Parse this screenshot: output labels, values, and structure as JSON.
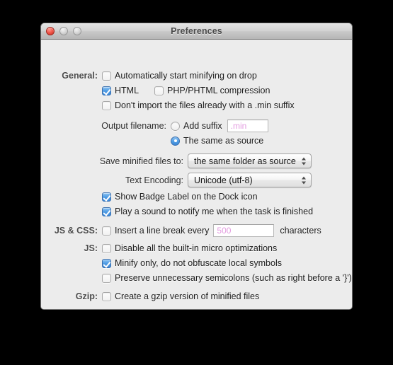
{
  "window": {
    "title": "Preferences",
    "controls": {
      "close": "close-button",
      "minimize": "minimize-button",
      "zoom": "zoom-button"
    }
  },
  "sections": {
    "general": {
      "label": "General:",
      "auto_start": {
        "label": "Automatically start minifying on drop",
        "checked": false
      },
      "html": {
        "label": "HTML",
        "checked": true
      },
      "php_phtml": {
        "label": "PHP/PHTML compression",
        "checked": false
      },
      "dont_import": {
        "label": "Don't import the files already with a .min suffix",
        "checked": false
      },
      "output_filename": {
        "label": "Output filename:",
        "add_suffix": {
          "label": "Add suffix",
          "selected": false
        },
        "suffix_field": {
          "value": "",
          "placeholder": ".min"
        },
        "same_as_source": {
          "label": "The same as source",
          "selected": true
        }
      },
      "save_minified_to": {
        "label": "Save minified files to:",
        "value": "the same folder as source"
      },
      "text_encoding": {
        "label": "Text Encoding:",
        "value": "Unicode (utf‑8)"
      },
      "badge_label": {
        "label": "Show Badge Label on the Dock icon",
        "checked": true
      },
      "play_sound": {
        "label": "Play a sound to notify me when the task is finished",
        "checked": true
      }
    },
    "js_css": {
      "label": "JS & CSS:",
      "line_break": {
        "label": "Insert a line break every",
        "checked": false
      },
      "line_break_field": {
        "value": "",
        "placeholder": "500"
      },
      "characters_suffix": "characters"
    },
    "js": {
      "label": "JS:",
      "disable_micro": {
        "label": "Disable all the built‑in micro optimizations",
        "checked": false
      },
      "minify_only": {
        "label": "Minify only, do not obfuscate local symbols",
        "checked": true
      },
      "preserve_semicolons": {
        "label": "Preserve unnecessary semicolons (such as right before a '}')",
        "checked": false
      }
    },
    "gzip": {
      "label": "Gzip:",
      "create_gzip": {
        "label": "Create a gzip version of minified files",
        "checked": false
      }
    }
  },
  "colors": {
    "accent": "#4e9ce4",
    "placeholder": "#e39ce0",
    "window_bg": "#ececec",
    "desktop_bg": "#000000"
  }
}
